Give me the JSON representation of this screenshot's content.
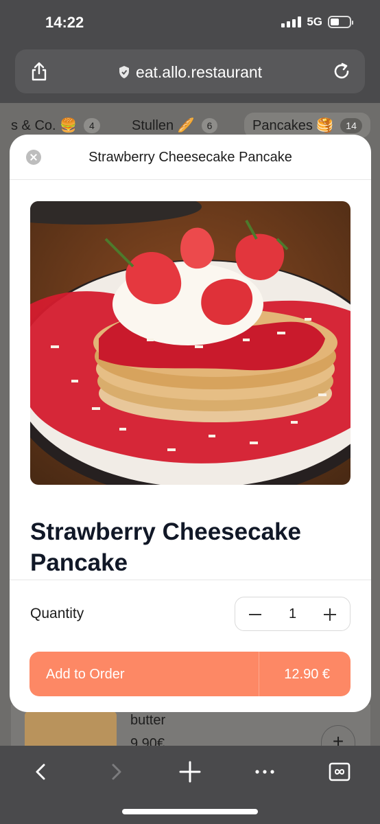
{
  "status_bar": {
    "time": "14:22",
    "network": "5G",
    "battery_level": 0.35
  },
  "browser": {
    "url": "eat.allo.restaurant",
    "icons": [
      "share-icon",
      "shield-icon",
      "reload-icon"
    ]
  },
  "categories": [
    {
      "label": "s & Co. 🍔",
      "count": "4"
    },
    {
      "label": "Stullen 🥖",
      "count": "6"
    },
    {
      "label": "Pancakes 🥞",
      "count": "14",
      "active": true
    }
  ],
  "background_item": {
    "text_line1": "butter",
    "text_line2": "9.90€"
  },
  "modal": {
    "title": "Strawberry Cheesecake Pancake",
    "product_name": "Strawberry Cheesecake Pancake",
    "quantity_label": "Quantity",
    "quantity": "1",
    "add_label": "Add to Order",
    "price": "12.90 €",
    "accent_color": "#fd8865"
  },
  "toolbar": {
    "icons": [
      "back-icon",
      "forward-icon",
      "new-tab-icon",
      "more-icon",
      "tabs-icon"
    ]
  }
}
